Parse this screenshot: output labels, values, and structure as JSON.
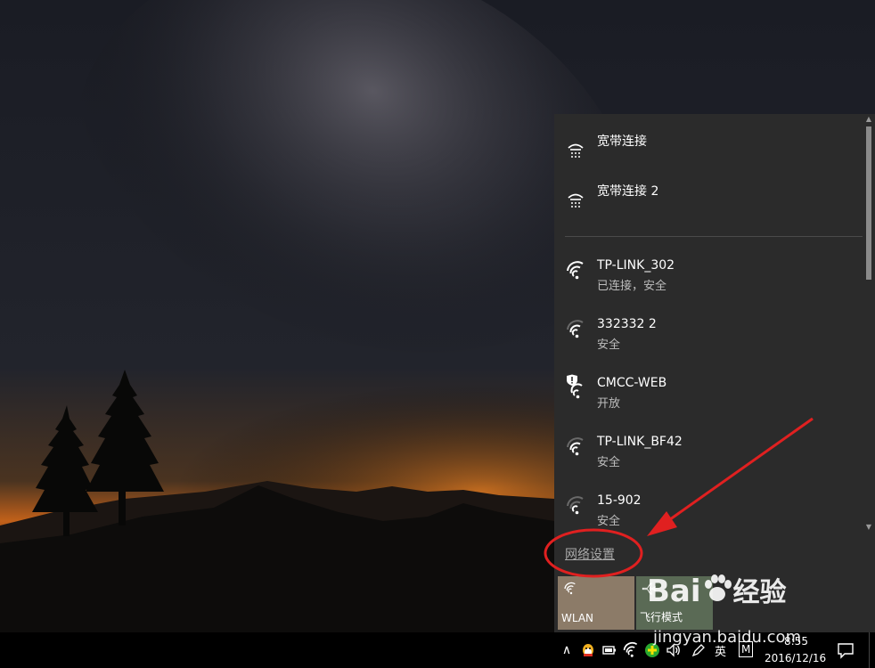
{
  "connections": [
    {
      "name": "宽带连接",
      "status": "",
      "type": "dialup",
      "kind": "dialup-icon"
    },
    {
      "name": "宽带连接 2",
      "status": "",
      "type": "dialup",
      "kind": "dialup-icon"
    },
    {
      "name": "TP-LINK_302",
      "status": "已连接，安全",
      "type": "wifi",
      "kind": "wifi-icon",
      "active": true
    },
    {
      "name": "332332 2",
      "status": "安全",
      "type": "wifi",
      "kind": "wifi-icon"
    },
    {
      "name": "CMCC-WEB",
      "status": "开放",
      "type": "wifi-open",
      "kind": "wifi-shield-icon"
    },
    {
      "name": "TP-LINK_BF42",
      "status": "安全",
      "type": "wifi",
      "kind": "wifi-icon"
    },
    {
      "name": "15-902",
      "status": "安全",
      "type": "wifi",
      "kind": "wifi-icon"
    }
  ],
  "network_settings_label": "网络设置",
  "tiles": {
    "wlan": {
      "label": "WLAN",
      "icon": "wifi-icon"
    },
    "airplane": {
      "label": "飞行模式",
      "icon": "airplane-icon"
    }
  },
  "taskbar": {
    "ime_label": "英",
    "m_label": "M",
    "time": "8:55",
    "date": "2016/12/16"
  },
  "watermark": {
    "logo_text": "Bai",
    "logo_text2": "经验",
    "url": "jingyan.baidu.com"
  },
  "colors": {
    "flyout_bg": "#2b2b2b",
    "annotation_red": "#e02020",
    "wlan_tile": "#8c7b68"
  }
}
